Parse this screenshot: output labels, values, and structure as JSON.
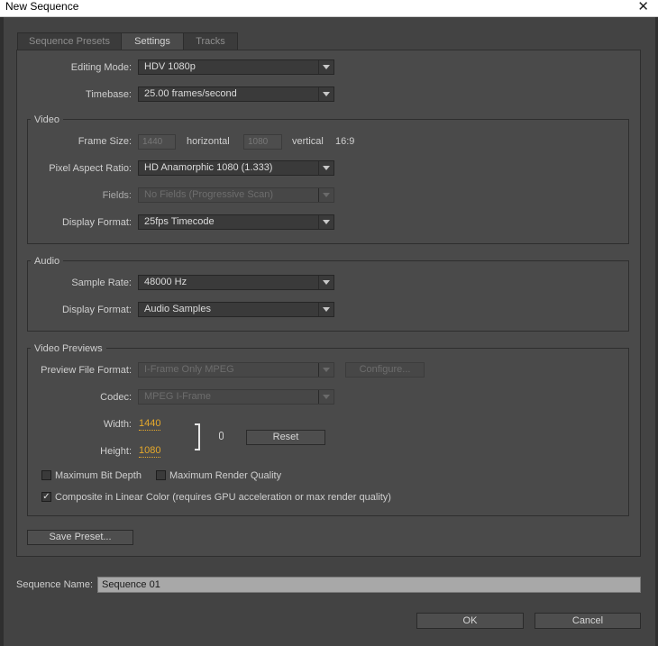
{
  "window": {
    "title": "New Sequence",
    "close_glyph": "✕"
  },
  "tabs": [
    {
      "label": "Sequence Presets",
      "active": false
    },
    {
      "label": "Settings",
      "active": true
    },
    {
      "label": "Tracks",
      "active": false
    }
  ],
  "settings": {
    "editing_mode": {
      "label": "Editing Mode:",
      "value": "HDV 1080p"
    },
    "timebase": {
      "label": "Timebase:",
      "value": "25.00 frames/second"
    }
  },
  "video": {
    "group_label": "Video",
    "frame_size": {
      "label": "Frame Size:",
      "width": "1440",
      "horizontal_label": "horizontal",
      "height": "1080",
      "vertical_label": "vertical",
      "aspect": "16:9"
    },
    "pixel_aspect": {
      "label": "Pixel Aspect Ratio:",
      "value": "HD Anamorphic 1080 (1.333)"
    },
    "fields": {
      "label": "Fields:",
      "value": "No Fields (Progressive Scan)"
    },
    "display_format": {
      "label": "Display Format:",
      "value": "25fps Timecode"
    }
  },
  "audio": {
    "group_label": "Audio",
    "sample_rate": {
      "label": "Sample Rate:",
      "value": "48000 Hz"
    },
    "display_format": {
      "label": "Display Format:",
      "value": "Audio Samples"
    }
  },
  "previews": {
    "group_label": "Video Previews",
    "file_format": {
      "label": "Preview File Format:",
      "value": "I-Frame Only MPEG"
    },
    "configure_label": "Configure...",
    "codec": {
      "label": "Codec:",
      "value": "MPEG I-Frame"
    },
    "width": {
      "label": "Width:",
      "value": "1440"
    },
    "height": {
      "label": "Height:",
      "value": "1080"
    },
    "reset_label": "Reset",
    "max_bit_depth": {
      "label": "Maximum Bit Depth",
      "checked": false
    },
    "max_render_quality": {
      "label": "Maximum Render Quality",
      "checked": false
    },
    "linear_color": {
      "label": "Composite in Linear Color (requires GPU acceleration or max render quality)",
      "checked": true
    },
    "check_glyph": "✓"
  },
  "save_preset_label": "Save Preset...",
  "sequence_name": {
    "label": "Sequence Name:",
    "value": "Sequence 01"
  },
  "buttons": {
    "ok": "OK",
    "cancel": "Cancel"
  },
  "colors": {
    "background": "#434343",
    "panel": "#4a4a4a",
    "accent_value": "#e6a92b"
  }
}
